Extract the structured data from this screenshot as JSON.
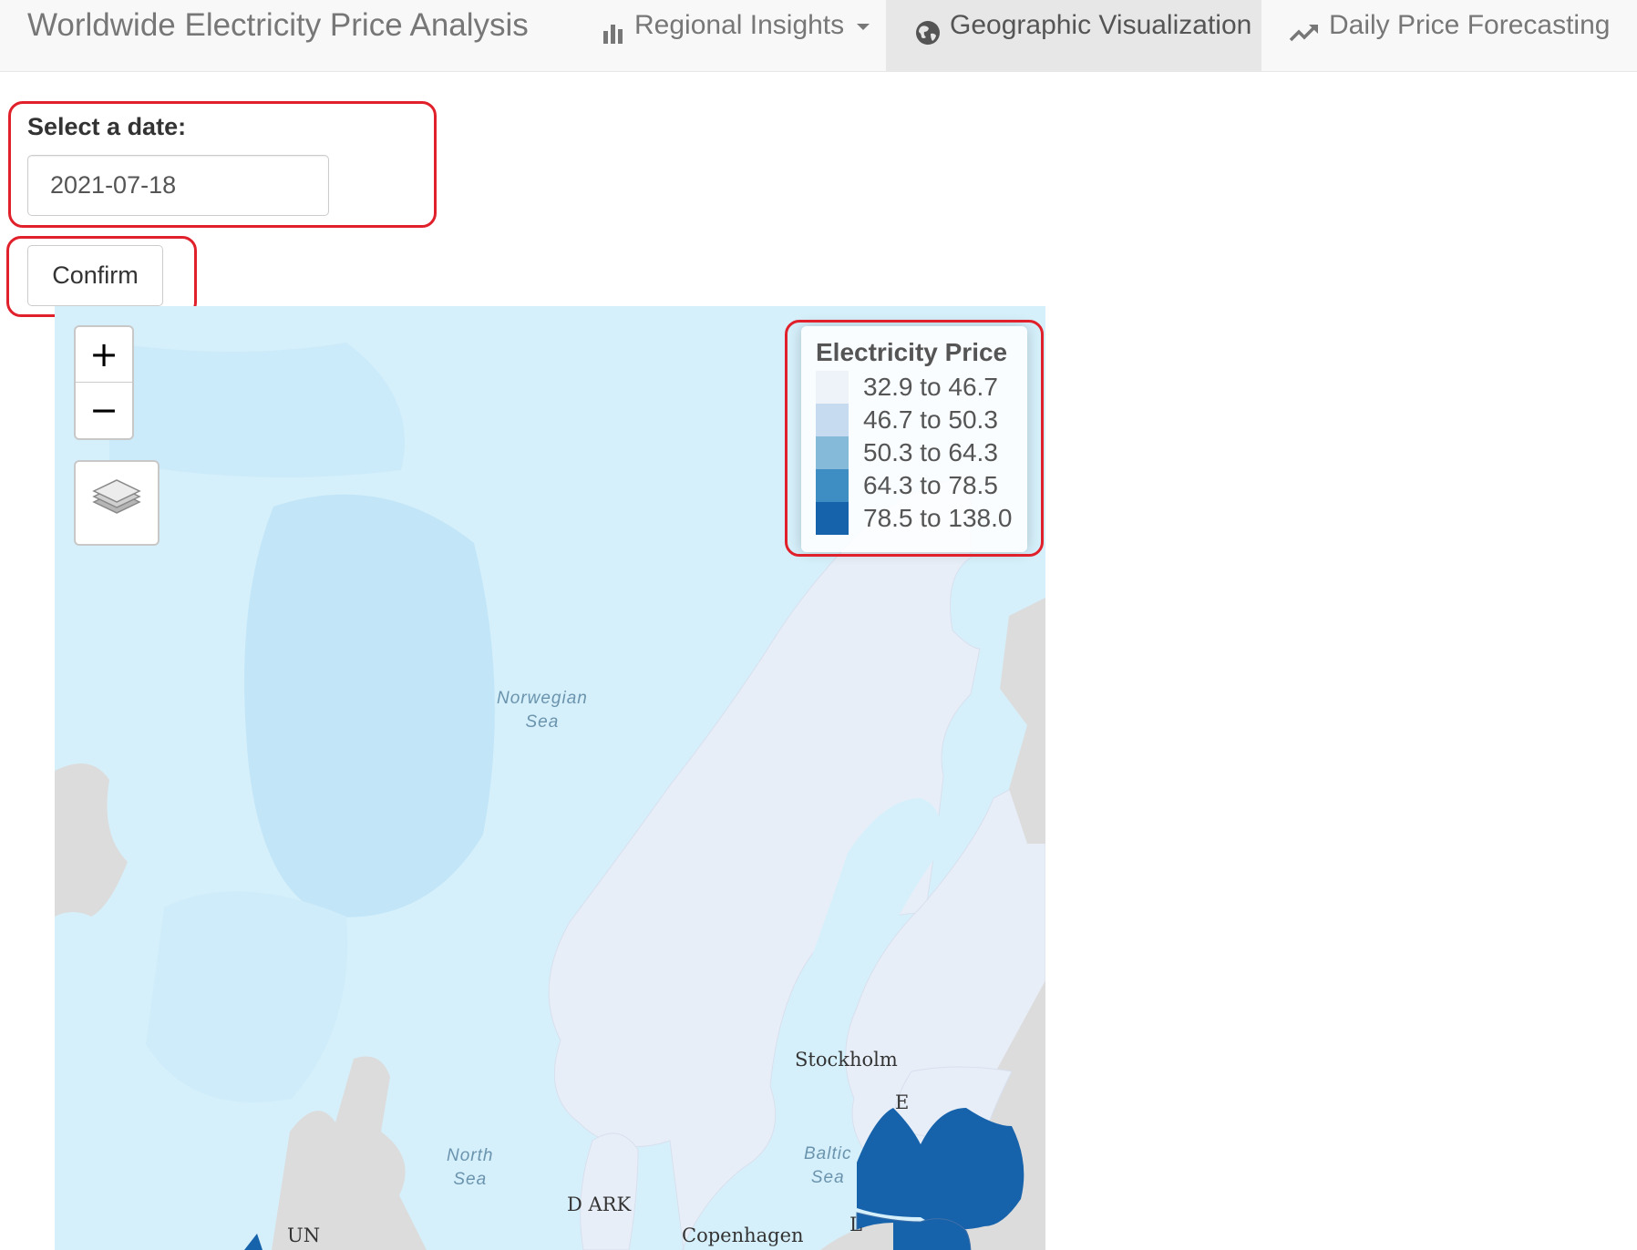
{
  "navbar": {
    "brand": "Worldwide Electricity Price Analysis",
    "items": [
      {
        "label": "Regional Insights",
        "icon": "bar-chart-icon",
        "dropdown": true,
        "active": false
      },
      {
        "label": "Geographic Visualization",
        "icon": "globe-icon",
        "active": true
      },
      {
        "label": "Daily Price Forecasting",
        "icon": "trend-up-icon",
        "active": false
      }
    ]
  },
  "form": {
    "date_label": "Select a date:",
    "date_value": "2021-07-18",
    "confirm_label": "Confirm"
  },
  "map": {
    "zoom_in": "+",
    "zoom_out": "−",
    "layers_icon": "layers-icon",
    "colors": {
      "sea": "#d6f0fb",
      "land_no_data": "#dcdcdc",
      "highlight": "#e0202a"
    },
    "legend": {
      "title": "Electricity Price",
      "bins": [
        {
          "label": "32.9 to 46.7",
          "color": "#eef3fa"
        },
        {
          "label": "46.7 to 50.3",
          "color": "#c6dbef"
        },
        {
          "label": "50.3 to 64.3",
          "color": "#86bad9"
        },
        {
          "label": "64.3 to 78.5",
          "color": "#3e8ec4"
        },
        {
          "label": "78.5 to 138.0",
          "color": "#1763ab"
        }
      ]
    },
    "sea_labels": {
      "norwegian": [
        "Norwegian",
        "Sea"
      ],
      "north": [
        "North",
        "Sea"
      ],
      "baltic": [
        "Baltic",
        "Sea"
      ]
    },
    "places": {
      "stockholm": "Stockholm",
      "copenhagen": "Copenhagen",
      "denmark": "D    ARK",
      "uk": "UN",
      "e": "E",
      "l": "L"
    }
  }
}
